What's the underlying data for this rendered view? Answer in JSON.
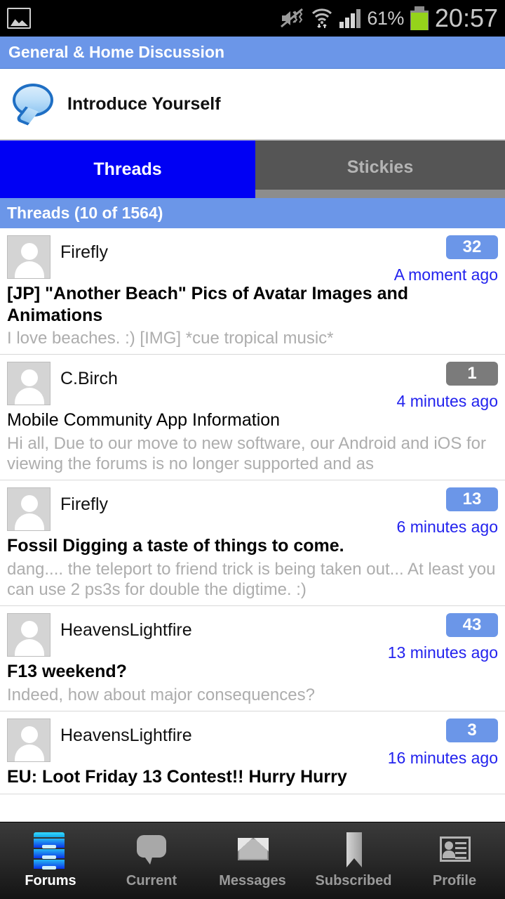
{
  "status_bar": {
    "image_icon": "image-icon",
    "mute_icon": "mute-vibrate-icon",
    "wifi_icon": "wifi-icon",
    "signal_icon": "signal-bars-icon",
    "battery_percent": "61%",
    "battery_icon": "battery-icon",
    "clock": "20:57"
  },
  "title_bar": {
    "title": "General & Home Discussion"
  },
  "forum_header": {
    "icon": "speech-bubble-icon",
    "name": "Introduce Yourself"
  },
  "tabs": [
    {
      "label": "Threads",
      "active": true
    },
    {
      "label": "Stickies",
      "active": false
    }
  ],
  "section_header": {
    "label": "Threads (10 of 1564)"
  },
  "threads": [
    {
      "author": "Firefly",
      "badge": "32",
      "badge_style": "blue",
      "time": "A moment ago",
      "title": "[JP] \"Another Beach\" Pics of Avatar Images and Animations",
      "preview": "I love beaches. :)   [IMG]   *cue tropical music*",
      "unread": true
    },
    {
      "author": "C.Birch",
      "badge": "1",
      "badge_style": "grey",
      "time": "4 minutes ago",
      "title": "Mobile Community App Information",
      "preview": "Hi all,   Due to our move to new software, our Android and iOS for viewing the forums is no longer supported and as",
      "unread": false
    },
    {
      "author": "Firefly",
      "badge": "13",
      "badge_style": "blue",
      "time": "6 minutes ago",
      "title": "Fossil Digging a taste of things to come.",
      "preview": "dang.... the teleport to friend trick is being taken out...   At least you can use 2 ps3s for double the digtime. :)",
      "unread": true
    },
    {
      "author": "HeavensLightfire",
      "badge": "43",
      "badge_style": "blue",
      "time": "13 minutes ago",
      "title": "F13 weekend?",
      "preview": "Indeed, how about major consequences?",
      "unread": true
    },
    {
      "author": "HeavensLightfire",
      "badge": "3",
      "badge_style": "blue",
      "time": "16 minutes ago",
      "title": "EU: Loot Friday 13 Contest!! Hurry Hurry",
      "preview": "",
      "unread": true
    }
  ],
  "bottom_nav": [
    {
      "label": "Forums",
      "icon": "filing-cabinet-icon",
      "active": true
    },
    {
      "label": "Current",
      "icon": "speech-bubble-icon",
      "active": false
    },
    {
      "label": "Messages",
      "icon": "envelope-icon",
      "active": false
    },
    {
      "label": "Subscribed",
      "icon": "bookmark-icon",
      "active": false
    },
    {
      "label": "Profile",
      "icon": "contact-card-icon",
      "active": false
    }
  ],
  "colors": {
    "header_blue": "#6b96e8",
    "active_tab_blue": "#0000f4",
    "inactive_tab_grey": "#555555",
    "link_blue": "#2222ee",
    "preview_grey": "#adadad",
    "battery_green": "#95d31b"
  }
}
